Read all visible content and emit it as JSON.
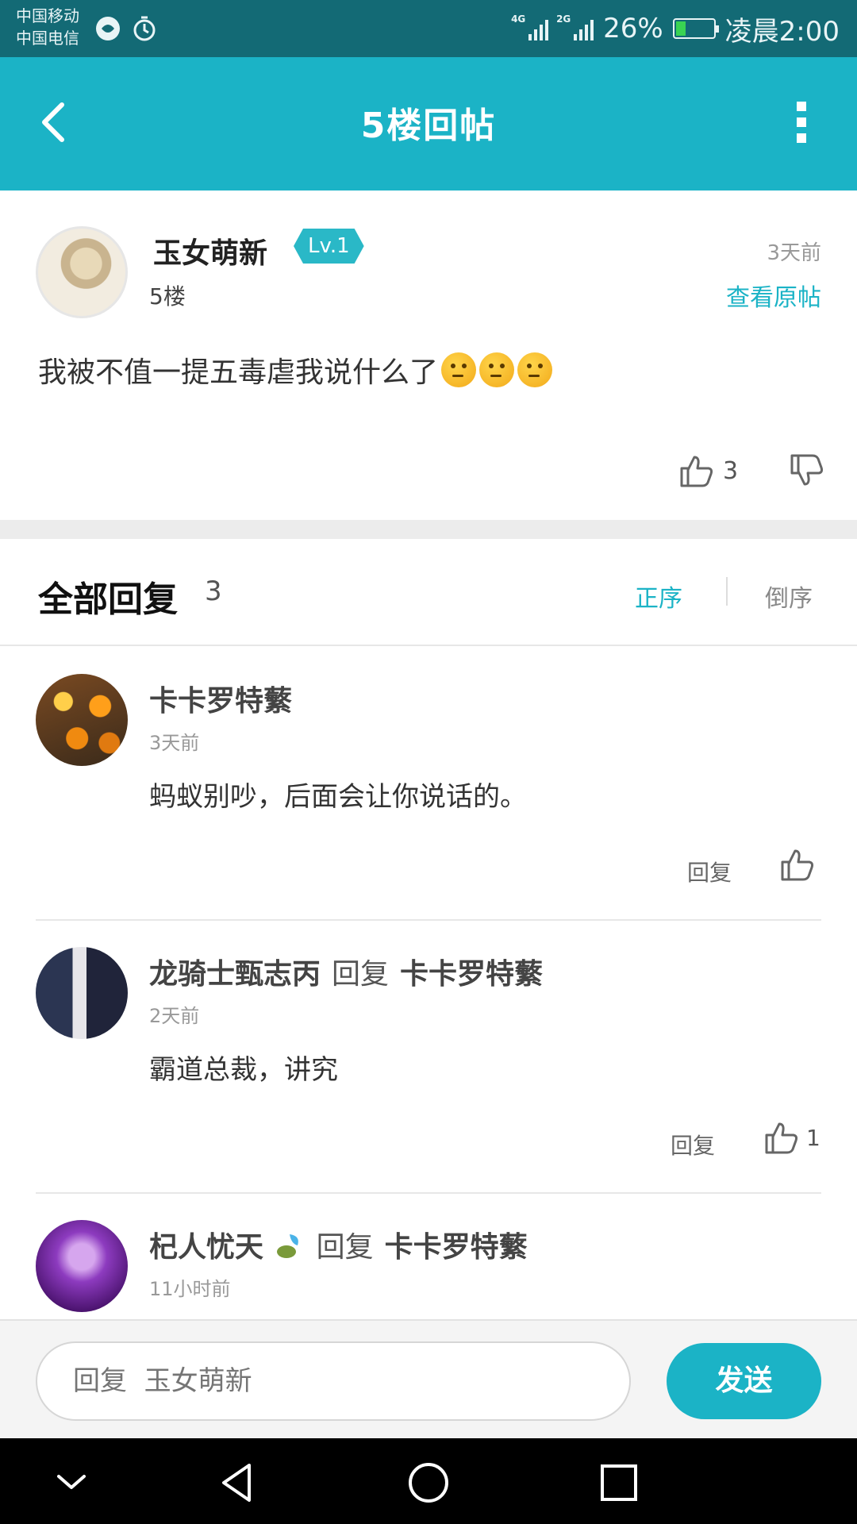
{
  "status_bar": {
    "carrier_1": "中国移动",
    "carrier_2": "中国电信",
    "net_1": "4G",
    "net_2": "2G",
    "battery": "26%",
    "battery_level": 0.26,
    "time": "凌晨2:00"
  },
  "header": {
    "title": "5楼回帖",
    "back_icon": "chevron-left-icon",
    "more_icon": "more-vertical-icon"
  },
  "post": {
    "author": "玉女萌新",
    "level": "Lv.1",
    "time": "3天前",
    "floor": "5楼",
    "view_original": "查看原帖",
    "text": "我被不值一提五毒虐我说什么了",
    "emojis": [
      "thinking-face",
      "thinking-face",
      "thinking-face"
    ],
    "likes": "3"
  },
  "replies_header": {
    "title": "全部回复",
    "count": "3",
    "sort_asc": "正序",
    "sort_desc": "倒序"
  },
  "replies": [
    {
      "author": "卡卡罗特蘩",
      "time": "3天前",
      "text": "蚂蚁别吵，后面会让你说话的。",
      "reply_label": "回复",
      "likes": ""
    },
    {
      "author": "龙骑士甄志丙",
      "reply_word": "回复",
      "target": "卡卡罗特蘩",
      "time": "2天前",
      "text": "霸道总裁，讲究",
      "reply_label": "回复",
      "likes": "1"
    },
    {
      "author": "杞人忧天",
      "reply_word": "回复",
      "target": "卡卡罗特蘩",
      "time": "11小时前"
    }
  ],
  "input_bar": {
    "placeholder": "回复  玉女萌新",
    "send_label": "发送"
  },
  "colors": {
    "accent": "#1bb3c6",
    "status_bar": "#136a75"
  }
}
